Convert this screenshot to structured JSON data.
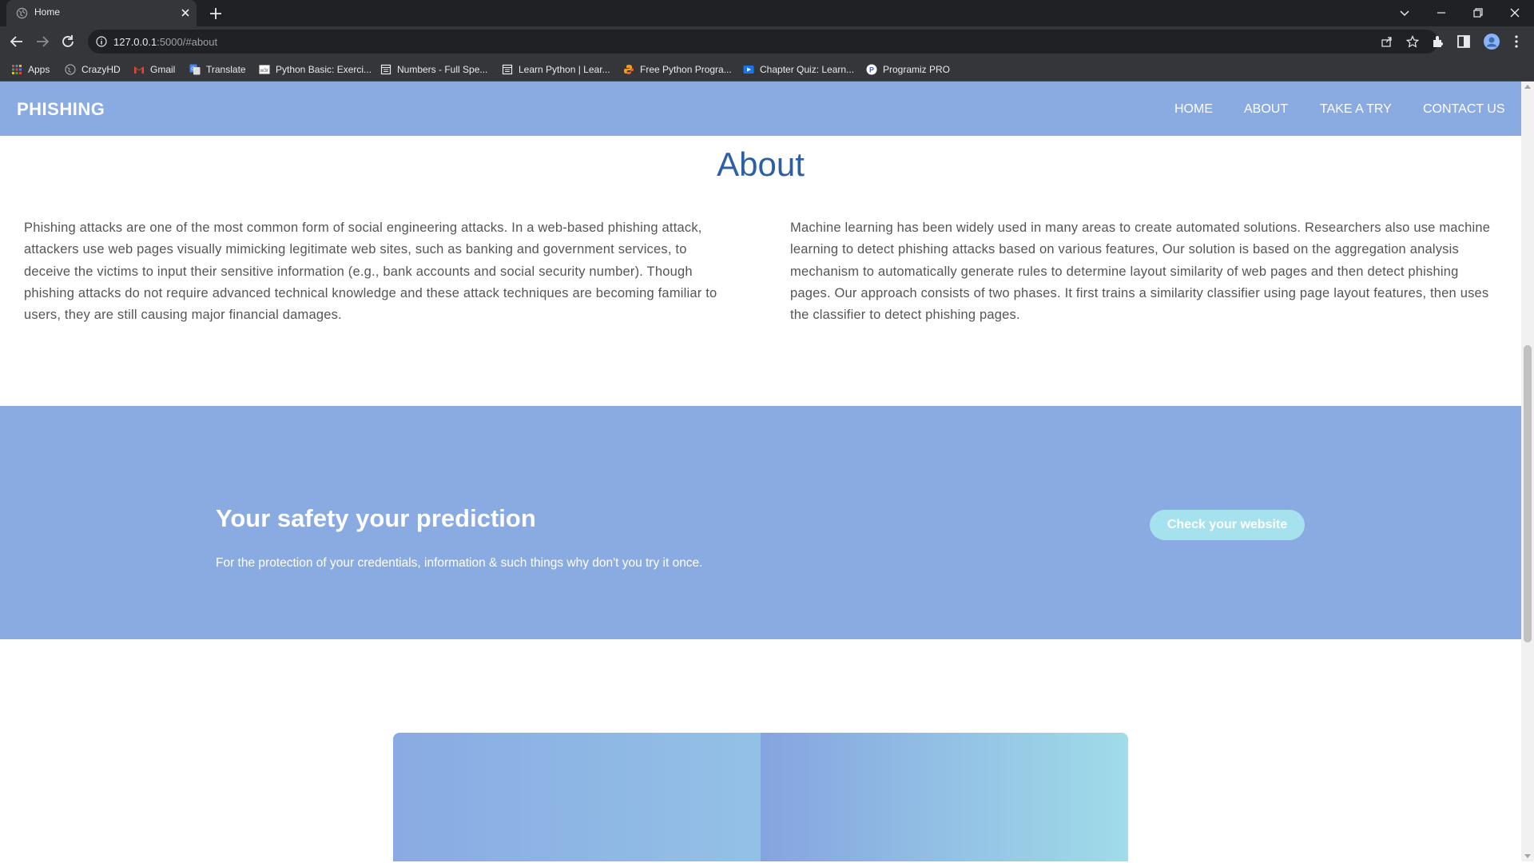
{
  "browser": {
    "tab_title": "Home",
    "url_host": "127.0.0.1",
    "url_path": ":5000/#about",
    "bookmarks": [
      {
        "label": "Apps",
        "icon": "apps-grid-icon"
      },
      {
        "label": "CrazyHD",
        "icon": "globe-icon"
      },
      {
        "label": "Gmail",
        "icon": "gmail-icon"
      },
      {
        "label": "Translate",
        "icon": "translate-icon"
      },
      {
        "label": "Python Basic: Exerci...",
        "icon": "w3resource-icon"
      },
      {
        "label": "Numbers - Full Spe...",
        "icon": "page-icon"
      },
      {
        "label": "Learn Python | Lear...",
        "icon": "page-icon"
      },
      {
        "label": "Free Python Progra...",
        "icon": "python-icon"
      },
      {
        "label": "Chapter Quiz: Learn...",
        "icon": "play-icon"
      },
      {
        "label": "Programiz PRO",
        "icon": "programiz-icon"
      }
    ]
  },
  "site": {
    "brand": "PHISHING",
    "nav": [
      "HOME",
      "ABOUT",
      "TAKE A TRY",
      "CONTACT US"
    ],
    "about": {
      "title": "About",
      "left_text": "Phishing attacks are one of the most common form of social engineering attacks. In a web-based phishing attack, attackers use web pages visually mimicking legitimate web sites, such as banking and government services, to deceive the victims to input their sensitive information (e.g., bank accounts and social security number). Though phishing attacks do not require advanced technical knowledge and these attack techniques are becoming familiar to users, they are still causing major financial damages.",
      "right_text": "Machine learning has been widely used in many areas to create automated solutions. Researchers also use machine learning to detect phishing attacks based on various features, Our solution is based on the aggregation analysis mechanism to automatically generate rules to determine layout similarity of web pages and then detect phishing pages. Our approach consists of two phases. It first trains a similarity classifier using page layout features, then uses the classifier to detect phishing pages."
    },
    "cta": {
      "heading": "Your safety your prediction",
      "text": "For the protection of your credentials, information & such things why don't you try it once.",
      "button": "Check your website"
    }
  },
  "colors": {
    "accent": "#8aaae2",
    "title_blue": "#2d5fa5",
    "button": "#a5e2ee"
  }
}
